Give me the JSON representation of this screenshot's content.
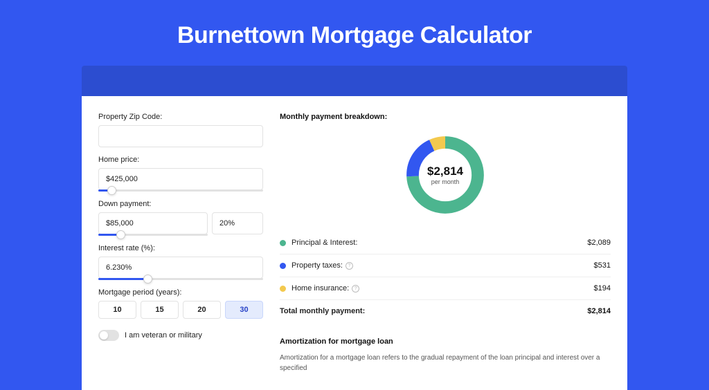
{
  "page_title": "Burnettown Mortgage Calculator",
  "form": {
    "zip_label": "Property Zip Code:",
    "zip_value": "",
    "home_price_label": "Home price:",
    "home_price_value": "$425,000",
    "home_price_slider_pct": 8,
    "down_payment_label": "Down payment:",
    "down_payment_value": "$85,000",
    "down_payment_pct": "20%",
    "down_payment_slider_pct": 20,
    "interest_label": "Interest rate (%):",
    "interest_value": "6.230%",
    "interest_slider_pct": 30,
    "period_label": "Mortgage period (years):",
    "periods": [
      "10",
      "15",
      "20",
      "30"
    ],
    "period_selected": "30",
    "veteran_label": "I am veteran or military"
  },
  "breakdown": {
    "title": "Monthly payment breakdown:",
    "total_value": "$2,814",
    "total_label": "per month",
    "items": [
      {
        "label": "Principal & Interest:",
        "value": "$2,089",
        "color": "#4cb58f",
        "has_info": false
      },
      {
        "label": "Property taxes:",
        "value": "$531",
        "color": "#3257f0",
        "has_info": true
      },
      {
        "label": "Home insurance:",
        "value": "$194",
        "color": "#f3c94e",
        "has_info": true
      }
    ],
    "total_row_label": "Total monthly payment:",
    "total_row_value": "$2,814"
  },
  "amortization": {
    "title": "Amortization for mortgage loan",
    "text": "Amortization for a mortgage loan refers to the gradual repayment of the loan principal and interest over a specified"
  },
  "chart_data": {
    "type": "pie",
    "title": "Monthly payment breakdown",
    "series": [
      {
        "name": "Principal & Interest",
        "value": 2089,
        "color": "#4cb58f"
      },
      {
        "name": "Property taxes",
        "value": 531,
        "color": "#3257f0"
      },
      {
        "name": "Home insurance",
        "value": 194,
        "color": "#f3c94e"
      }
    ],
    "total": 2814,
    "center_label": "per month"
  }
}
